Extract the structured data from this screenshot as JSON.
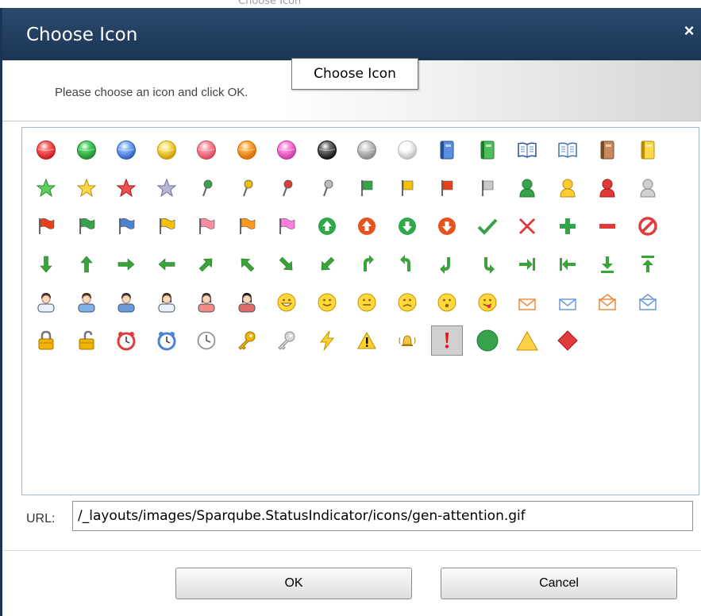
{
  "backdrop": {
    "title_fragment": "Choose Icon"
  },
  "dialog": {
    "title": "Choose Icon",
    "close_glyph": "×",
    "instruction": "Please choose an icon and click OK.",
    "tooltip": "Choose Icon"
  },
  "icon_rows": [
    [
      "red-orb-icon",
      "green-orb-icon",
      "blue-orb-icon",
      "yellow-orb-icon",
      "pink-orb-icon",
      "orange-orb-icon",
      "magenta-orb-icon",
      "black-orb-icon",
      "gray-orb-icon",
      "white-orb-icon",
      "blue-book-icon",
      "green-book-icon",
      "open-blue-book-icon",
      "open-book-icon",
      "brown-book-icon",
      "yellow-book-icon"
    ],
    [
      "green-star-icon",
      "yellow-star-icon",
      "red-star-icon",
      "gray-star-icon",
      "green-pin-icon",
      "yellow-pin-icon",
      "red-pin-icon",
      "gray-pin-icon",
      "green-flag-icon",
      "yellow-flag-icon",
      "red-flag-icon",
      "gray-flag-icon",
      "green-user-icon",
      "yellow-user-icon",
      "red-user-icon",
      "gray-user-icon"
    ],
    [
      "red-flag-wave-icon",
      "green-flag-wave-icon",
      "blue-flag-wave-icon",
      "yellow-flag-wave-icon",
      "pink-flag-wave-icon",
      "orange-flag-wave-icon",
      "magenta-flag-wave-icon",
      "green-up-circle-icon",
      "red-up-circle-icon",
      "green-down-circle-icon",
      "red-down-circle-icon",
      "checkmark-icon",
      "red-x-icon",
      "green-plus-icon",
      "red-minus-icon",
      "no-entry-icon"
    ],
    [
      "arrow-down-icon",
      "arrow-up-icon",
      "arrow-right-icon",
      "arrow-left-icon",
      "arrow-up-right-icon",
      "arrow-up-left-icon",
      "arrow-down-right-icon",
      "arrow-down-left-icon",
      "curve-arrow-down-left-icon",
      "curve-arrow-down-right-icon",
      "curve-arrow-up-right-icon",
      "curve-arrow-up-left-icon",
      "arrow-right-bar-icon",
      "arrow-left-bar-icon",
      "download-icon",
      "upload-icon"
    ],
    [
      "user-white-icon",
      "user-blue-icon",
      "user-green-tie-icon",
      "user-female-white-icon",
      "user-female-red-icon",
      "user-female-dark-icon",
      "grin-face-icon",
      "smile-face-icon",
      "neutral-face-icon",
      "sad-face-icon",
      "surprised-face-icon",
      "tongue-face-icon",
      "orange-envelope-icon",
      "blue-envelope-icon",
      "orange-envelope-open-icon",
      "blue-envelope-open-icon"
    ],
    [
      "padlock-closed-icon",
      "padlock-open-icon",
      "red-alarm-clock-icon",
      "blue-alarm-clock-icon",
      "clock-icon",
      "gold-key-icon",
      "silver-key-icon",
      "lightning-icon",
      "warning-triangle-icon",
      "alarm-bell-icon",
      "attention-icon",
      "green-circle-icon",
      "yellow-triangle-icon",
      "red-diamond-icon"
    ]
  ],
  "selected_icon": "attention-icon",
  "url_field": {
    "label": "URL:",
    "value": "/_layouts/images/Sparqube.StatusIndicator/icons/gen-attention.gif"
  },
  "buttons": {
    "ok": "OK",
    "cancel": "Cancel"
  }
}
